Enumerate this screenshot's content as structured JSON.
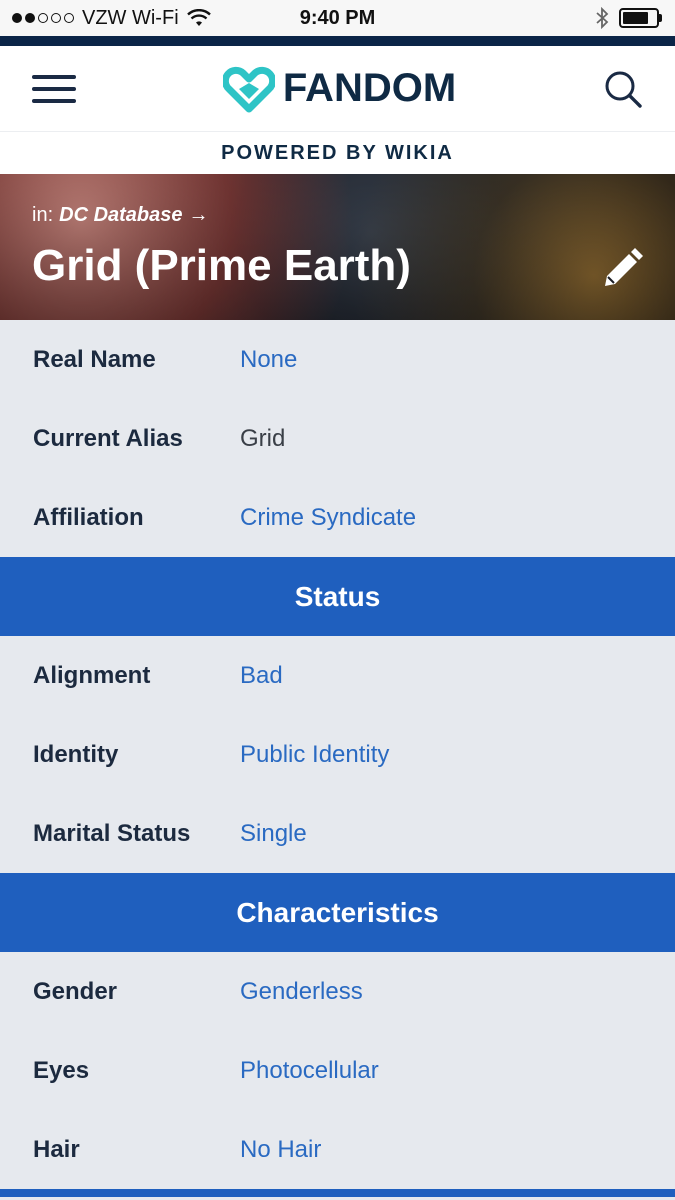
{
  "statusbar": {
    "carrier": "VZW Wi-Fi",
    "time": "9:40 PM"
  },
  "header": {
    "logo": "FANDOM",
    "powered_by": "POWERED BY WIKIA"
  },
  "hero": {
    "breadcrumb_prefix": "in:",
    "wiki_name": "DC Database",
    "arrow": "→",
    "title": "Grid (Prime Earth)"
  },
  "infobox": {
    "rows_top": [
      {
        "label": "Real Name",
        "value": "None"
      },
      {
        "label": "Current Alias",
        "value": "Grid"
      },
      {
        "label": "Affiliation",
        "value": "Crime Syndicate"
      }
    ],
    "status_header": "Status",
    "status_rows": [
      {
        "label": "Alignment",
        "value": "Bad"
      },
      {
        "label": "Identity",
        "value": "Public Identity"
      },
      {
        "label": "Marital Status",
        "value": "Single"
      }
    ],
    "characteristics_header": "Characteristics",
    "characteristics_rows": [
      {
        "label": "Gender",
        "value": "Genderless"
      },
      {
        "label": "Eyes",
        "value": "Photocellular"
      },
      {
        "label": "Hair",
        "value": "No Hair"
      }
    ]
  },
  "colors": {
    "link": "#2a6ac2",
    "section": "#1f5fbe",
    "brand_teal": "#2ec4c6",
    "navy": "#0f2a44"
  },
  "icons": [
    "menu-icon",
    "fandom-heart-icon",
    "search-icon",
    "pencil-icon",
    "wifi-icon",
    "bluetooth-icon",
    "battery-icon"
  ]
}
